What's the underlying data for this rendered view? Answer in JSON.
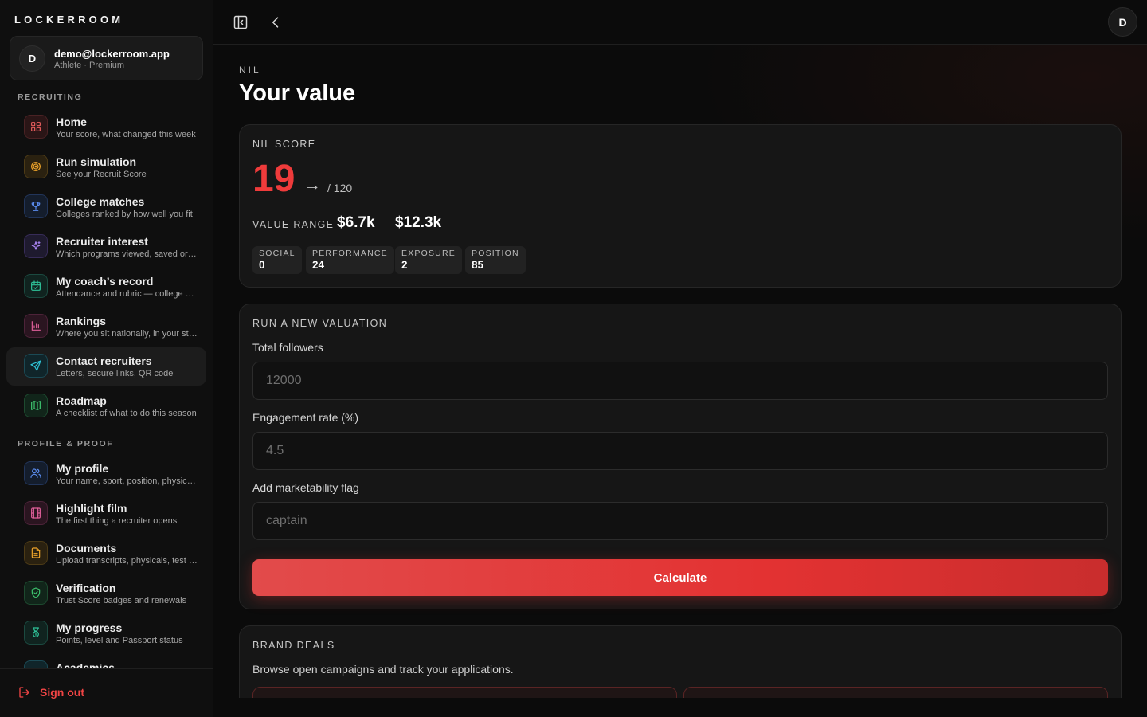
{
  "brand": "LOCKERROOM",
  "account": {
    "initial": "D",
    "email": "demo@lockerroom.app",
    "role": "Athlete · Premium"
  },
  "sections": {
    "recruiting": "RECRUITING",
    "profile_proof": "PROFILE & PROOF"
  },
  "nav_recruiting": [
    {
      "title": "Home",
      "sub": "Your score, what changed this week",
      "icon": "grid-icon"
    },
    {
      "title": "Run simulation",
      "sub": "See your Recruit Score",
      "icon": "target-icon"
    },
    {
      "title": "College matches",
      "sub": "Colleges ranked by how well you fit",
      "icon": "trophy-icon"
    },
    {
      "title": "Recruiter interest",
      "sub": "Which programs viewed, saved or messaged you",
      "icon": "sparkle-icon"
    },
    {
      "title": "My coach’s record",
      "sub": "Attendance and rubric — college coaches see this",
      "icon": "calendar-check-icon"
    },
    {
      "title": "Rankings",
      "sub": "Where you sit nationally, in your state and position",
      "icon": "bar-chart-icon"
    },
    {
      "title": "Contact recruiters",
      "sub": "Letters, secure links, QR code",
      "icon": "send-icon"
    },
    {
      "title": "Roadmap",
      "sub": "A checklist of what to do this season",
      "icon": "map-icon"
    }
  ],
  "nav_profile": [
    {
      "title": "My profile",
      "sub": "Your name, sport, position, physicals",
      "icon": "users-icon"
    },
    {
      "title": "Highlight film",
      "sub": "The first thing a recruiter opens",
      "icon": "film-icon"
    },
    {
      "title": "Documents",
      "sub": "Upload transcripts, physicals, test scores",
      "icon": "document-icon"
    },
    {
      "title": "Verification",
      "sub": "Trust Score badges and renewals",
      "icon": "shield-check-icon"
    },
    {
      "title": "My progress",
      "sub": "Points, level and Passport status",
      "icon": "medal-icon"
    },
    {
      "title": "Academics",
      "sub": "",
      "icon": "book-icon"
    }
  ],
  "sign_out": "Sign out",
  "top_avatar": "D",
  "page": {
    "eyebrow": "NIL",
    "title": "Your value"
  },
  "nil_score": {
    "label": "NIL SCORE",
    "score": "19",
    "arrow": "→",
    "max": "/ 120",
    "range_label": "VALUE RANGE",
    "range_low": "$6.7k",
    "range_sep": "–",
    "range_high": "$12.3k",
    "chips": [
      {
        "k": "SOCIAL",
        "v": "0"
      },
      {
        "k": "PERFORMANCE",
        "v": "24"
      },
      {
        "k": "EXPOSURE",
        "v": "2"
      },
      {
        "k": "POSITION",
        "v": "85"
      }
    ]
  },
  "valuation": {
    "label": "RUN A NEW VALUATION",
    "followers_label": "Total followers",
    "followers_placeholder": "12000",
    "engagement_label": "Engagement rate (%)",
    "engagement_placeholder": "4.5",
    "flag_label": "Add marketability flag",
    "flag_placeholder": "captain",
    "button": "Calculate"
  },
  "brand_deals": {
    "label": "BRAND DEALS",
    "desc": "Browse open campaigns and track your applications."
  },
  "colors": {
    "accent": "#ef3b3b",
    "background": "#0b0b0b",
    "card": "#161616"
  }
}
